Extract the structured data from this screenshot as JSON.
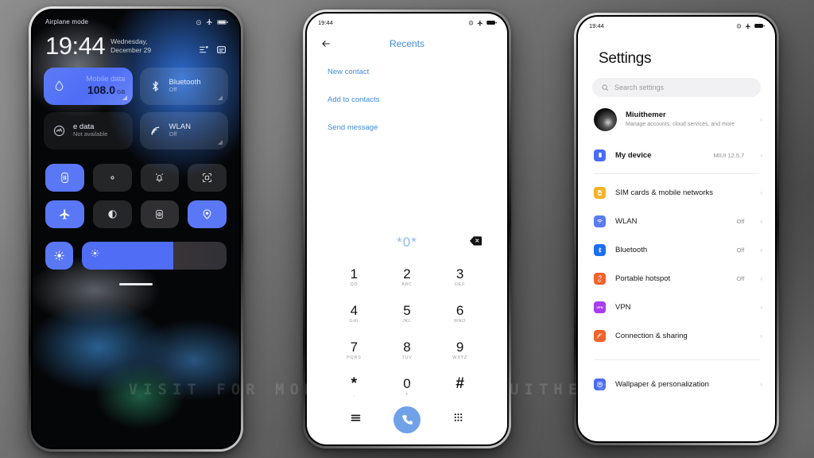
{
  "watermark": "VISIT FOR MORE THEMES - MIUITHEMER.COM",
  "colors": {
    "accent_blue": "#5a78f6",
    "dialer_blue": "#3f8ce0",
    "call_green_blue": "#6fa2e8",
    "tile_on": "#4f6df5"
  },
  "left_phone": {
    "status_bar": {
      "carrier_text": "Airplane mode",
      "icons": [
        "alarm-icon",
        "airplane-icon",
        "battery-icon"
      ]
    },
    "clock": {
      "time": "19:44",
      "date_line1": "Wednesday,",
      "date_line2": "December 29"
    },
    "header_icons": [
      "settings-sliders-icon",
      "notification-icon"
    ],
    "big_tiles": [
      {
        "name": "mobile-data",
        "title": "Mobile data",
        "value": "108.0",
        "unit": "GB",
        "state": "on",
        "icon": "data-drop-icon"
      },
      {
        "name": "bluetooth",
        "title": "Bluetooth",
        "sub": "Off",
        "state": "off",
        "icon": "bluetooth-icon"
      },
      {
        "name": "mobile-data-secondary",
        "title": "e data",
        "sub": "Not available",
        "state": "dim",
        "icon": "data-usage-icon"
      },
      {
        "name": "wlan",
        "title": "WLAN",
        "sub": "Off",
        "state": "off",
        "icon": "wifi-icon"
      }
    ],
    "small_tiles": [
      {
        "name": "auto-rotate",
        "icon": "rotation-lock-icon",
        "state": "on"
      },
      {
        "name": "flashlight",
        "icon": "flashlight-icon",
        "state": "off"
      },
      {
        "name": "silent-mode",
        "icon": "bell-vibrate-icon",
        "state": "off"
      },
      {
        "name": "screenshot",
        "icon": "screenshot-icon",
        "state": "off"
      },
      {
        "name": "airplane-mode",
        "icon": "airplane-icon",
        "state": "on"
      },
      {
        "name": "dark-mode",
        "icon": "moon-icon",
        "state": "off"
      },
      {
        "name": "reading-mode",
        "icon": "reading-mode-icon",
        "state": "off2"
      },
      {
        "name": "location",
        "icon": "location-icon",
        "state": "on"
      }
    ],
    "brightness": {
      "icon": "brightness-icon",
      "slider_icon": "brightness-icon",
      "level_percent": 63
    },
    "home_indicator": true
  },
  "mid_phone": {
    "status_bar": {
      "time": "19:44",
      "icons": [
        "alarm-icon",
        "airplane-icon",
        "battery-icon"
      ]
    },
    "app_bar": {
      "back_icon": "back-arrow-icon",
      "title": "Recents"
    },
    "links": [
      {
        "name": "new-contact",
        "label": "New contact"
      },
      {
        "name": "add-to-contacts",
        "label": "Add to contacts"
      },
      {
        "name": "send-message",
        "label": "Send message"
      }
    ],
    "entry": {
      "number": "*0*",
      "delete_icon": "backspace-icon"
    },
    "keypad": [
      {
        "digit": "1",
        "sub": "QD"
      },
      {
        "digit": "2",
        "sub": "ABC"
      },
      {
        "digit": "3",
        "sub": "DEF"
      },
      {
        "digit": "4",
        "sub": "GHI"
      },
      {
        "digit": "5",
        "sub": "JKL"
      },
      {
        "digit": "6",
        "sub": "MNO"
      },
      {
        "digit": "7",
        "sub": "PQRS"
      },
      {
        "digit": "8",
        "sub": "TUV"
      },
      {
        "digit": "9",
        "sub": "WXYZ"
      },
      {
        "digit": "*",
        "sub": ","
      },
      {
        "digit": "0",
        "sub": "+"
      },
      {
        "digit": "#",
        "sub": ""
      }
    ],
    "bottom_bar": {
      "menu_icon": "menu-lines-icon",
      "call_icon": "call-icon",
      "dialpad_icon": "dialpad-icon"
    }
  },
  "right_phone": {
    "status_bar": {
      "time": "19:44",
      "icons": [
        "alarm-icon",
        "airplane-icon",
        "battery-icon"
      ]
    },
    "title": "Settings",
    "search": {
      "placeholder": "Search settings",
      "icon": "search-icon"
    },
    "account": {
      "name": "Miuithemer",
      "subtitle": "Manage accounts, cloud services, and more",
      "chevron": "›"
    },
    "rows": [
      {
        "name": "my-device",
        "label": "My device",
        "value": "MIUI 12.5.7",
        "icon": "device-icon",
        "icon_color": "#4a6cf0",
        "bold": true
      },
      {
        "name": "sim-cards-mobile-networks",
        "label": "SIM cards & mobile networks",
        "value": "",
        "icon": "sim-icon",
        "icon_color": "#f5b328"
      },
      {
        "name": "wlan",
        "label": "WLAN",
        "value": "Off",
        "icon": "wifi-icon",
        "icon_color": "#5a7cf0"
      },
      {
        "name": "bluetooth",
        "label": "Bluetooth",
        "value": "Off",
        "icon": "bluetooth-icon",
        "icon_color": "#1d6ff2"
      },
      {
        "name": "portable-hotspot",
        "label": "Portable hotspot",
        "value": "Off",
        "icon": "hotspot-icon",
        "icon_color": "#f2622c"
      },
      {
        "name": "vpn",
        "label": "VPN",
        "value": "",
        "icon": "vpn-icon",
        "icon_color": "#a63df0"
      },
      {
        "name": "connection-sharing",
        "label": "Connection & sharing",
        "value": "",
        "icon": "sharing-icon",
        "icon_color": "#f2622c"
      },
      {
        "name": "wallpaper-personalization",
        "label": "Wallpaper & personalization",
        "value": "",
        "icon": "wallpaper-icon",
        "icon_color": "#4a6cf0"
      }
    ],
    "chevron": "›"
  }
}
